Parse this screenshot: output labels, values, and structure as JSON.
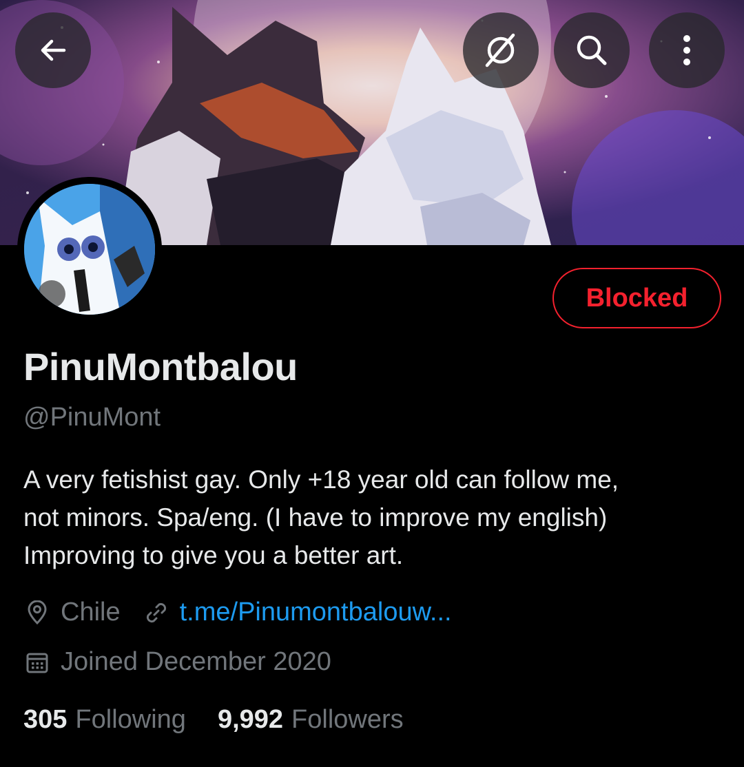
{
  "header": {
    "back_icon": "arrow-left-icon",
    "grok_icon": "grok-icon",
    "search_icon": "search-icon",
    "more_icon": "more-vertical-icon"
  },
  "profile": {
    "display_name": "PinuMontbalou",
    "handle": "@PinuMont",
    "bio": "A very fetishist gay. Only +18 year old can follow me,\nnot minors. Spa/eng. (I have to improve my english)\nImproving to give you a better art.",
    "location": "Chile",
    "website": "t.me/Pinumontbalouw...",
    "joined": "Joined December 2020",
    "block_button_label": "Blocked"
  },
  "stats": {
    "following_count": "305",
    "following_label": "Following",
    "followers_count": "9,992",
    "followers_label": "Followers"
  },
  "colors": {
    "background": "#000000",
    "text_primary": "#e7e9ea",
    "text_secondary": "#71767b",
    "link": "#1d9bf0",
    "blocked_red": "#f4212e"
  }
}
